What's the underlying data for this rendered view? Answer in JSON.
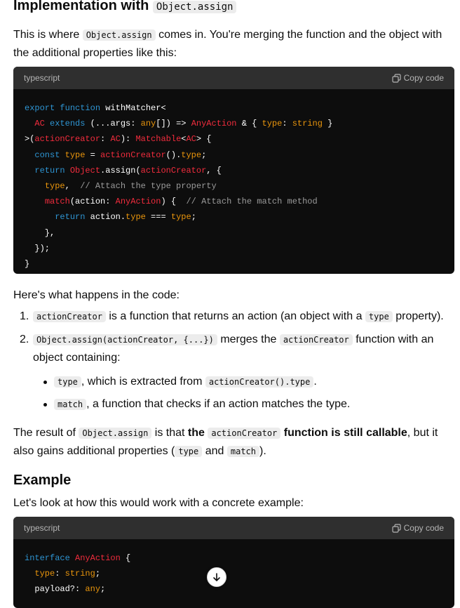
{
  "heading": {
    "text": "Implementation with",
    "code": "Object.assign"
  },
  "intro": {
    "part1": "This is where",
    "code": "Object.assign",
    "part2": "comes in. You're merging the function and the object with the additional properties like this:"
  },
  "code_block_1": {
    "language": "typescript",
    "copy_label": "Copy code",
    "lines": [
      "export function withMatcher<",
      "  AC extends (...args: any[]) => AnyAction & { type: string }",
      ">(actionCreator: AC): Matchable<AC> {",
      "  const type = actionCreator().type;",
      "  return Object.assign(actionCreator, {",
      "    type,  // Attach the type property",
      "    match(action: AnyAction) {  // Attach the match method",
      "      return action.type === type;",
      "    },",
      "  });",
      "}"
    ]
  },
  "explain": {
    "lead": "Here's what happens in the code:",
    "items": [
      {
        "number": "1.",
        "code": "actionCreator",
        "text": "is a function that returns an action (an object with a",
        "code2": "type",
        "text2": "property)."
      },
      {
        "number": "2.",
        "code": "Object.assign(actionCreator, {...})",
        "text": "merges the",
        "code2": "actionCreator",
        "text2": "function with an object containing:"
      }
    ],
    "subitems": [
      {
        "code": "type",
        "text": ", which is extracted from",
        "code2": "actionCreator().type",
        "text2": "."
      },
      {
        "code": "match",
        "text": ", a function that checks if an action matches the type."
      }
    ]
  },
  "result": {
    "part1": "The result of",
    "code1": "Object.assign",
    "part2": "is that",
    "bold1": "the",
    "code2": "actionCreator",
    "bold2": "function is still callable",
    "part3": ", but it also gains additional properties (",
    "code3": "type",
    "part4": "and",
    "code4": "match",
    "part5": ")."
  },
  "example": {
    "heading": "Example",
    "lead": "Let's look at how this would work with a concrete example:"
  },
  "code_block_2": {
    "language": "typescript",
    "copy_label": "Copy code",
    "lines": [
      "interface AnyAction {",
      "  type: string;",
      "  payload?: any;"
    ]
  },
  "scroll_button": {
    "icon": "arrow-down-icon"
  }
}
